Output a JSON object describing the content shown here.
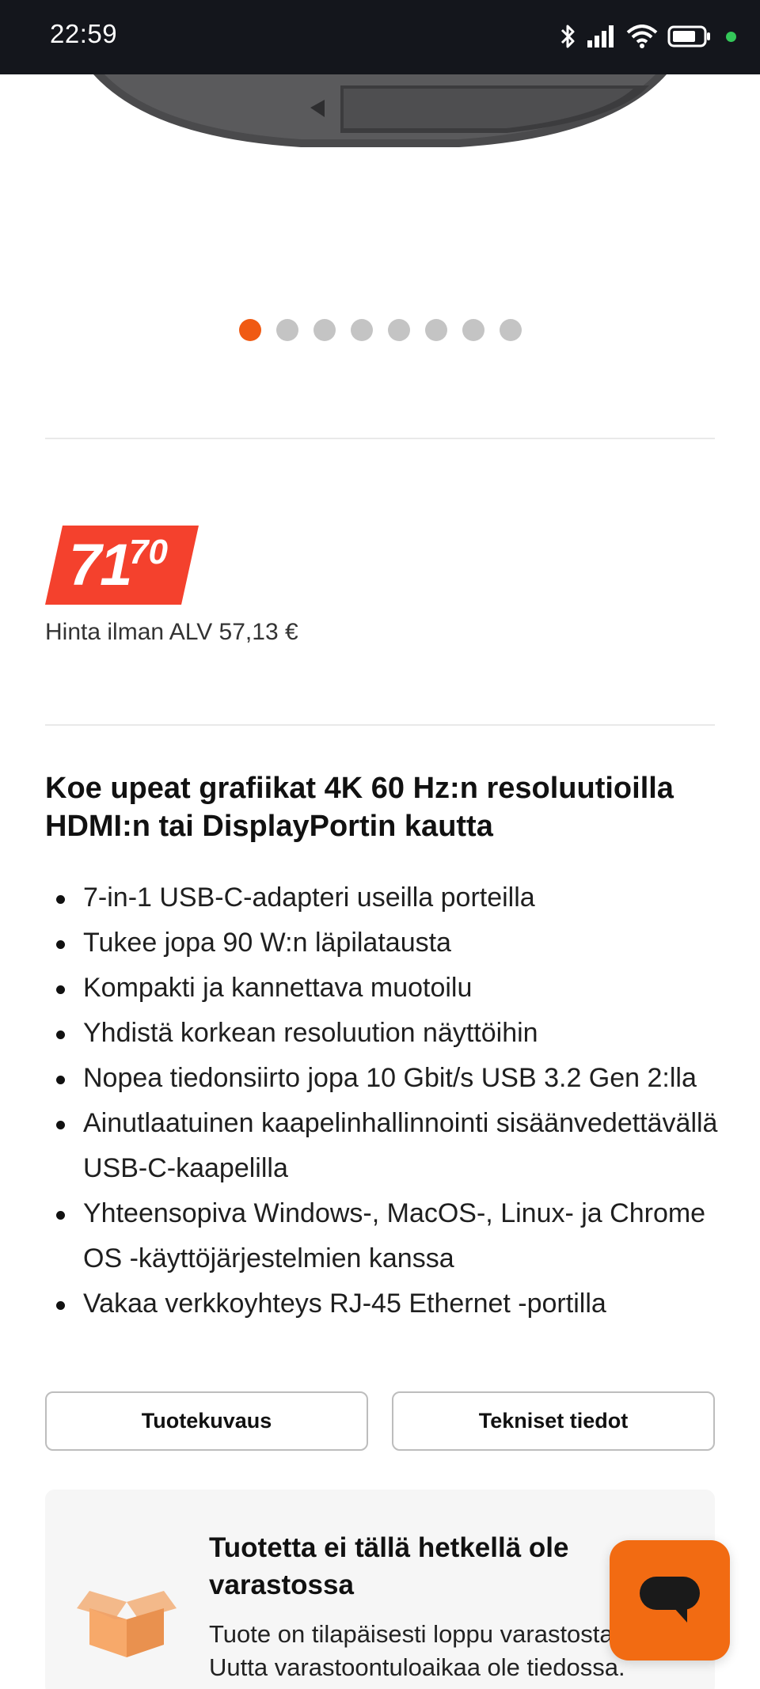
{
  "status": {
    "time": "22:59"
  },
  "gallery": {
    "dot_count": 8,
    "active_index": 0,
    "accent_color": "#f05a13"
  },
  "price": {
    "main": "71",
    "cents": "70",
    "vat_text": "Hinta ilman ALV 57,13 €",
    "tag_color": "#f4412d"
  },
  "product": {
    "headline": "Koe upeat grafiikat 4K 60 Hz:n resoluutioilla HDMI:n tai DisplayPortin kautta",
    "features": [
      "7-in-1 USB-C-adapteri useilla porteilla",
      "Tukee jopa 90 W:n läpilatausta",
      "Kompakti ja kannettava muotoilu",
      "Yhdistä korkean resoluution näyttöihin",
      "Nopea tiedonsiirto jopa 10 Gbit/s USB 3.2 Gen 2:lla",
      "Ainutlaatuinen kaapelinhallinnointi sisäänvedettävällä USB-C-kaapelilla",
      "Yhteensopiva Windows-, MacOS-, Linux- ja Chrome OS -käyttöjärjestelmien kanssa",
      "Vakaa verkkoyhteys RJ-45 Ethernet -portilla"
    ]
  },
  "tabs": {
    "description": "Tuotekuvaus",
    "specs": "Tekniset tiedot"
  },
  "stock": {
    "title": "Tuotetta ei tällä hetkellä ole varastossa",
    "text": "Tuote on tilapäisesti loppu varastosta. Uutta varastoontuloaikaa ole tiedossa."
  },
  "chat": {
    "icon": "chat-bubble-icon",
    "color": "#f26b12"
  }
}
